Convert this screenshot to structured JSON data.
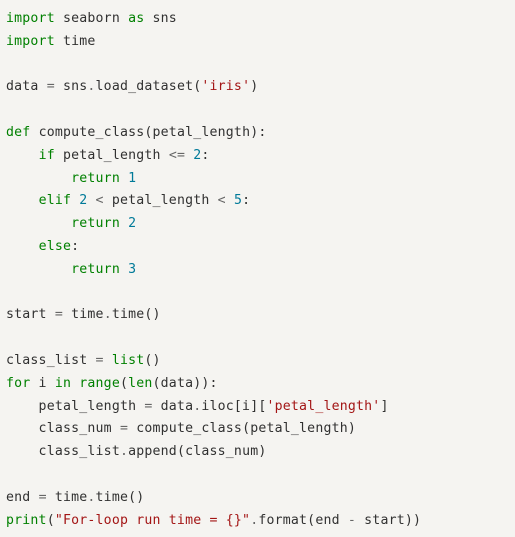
{
  "code": {
    "tokens": [
      [
        [
          "import",
          "kw"
        ],
        [
          " ",
          "nm"
        ],
        [
          "seaborn",
          "nm"
        ],
        [
          " ",
          "nm"
        ],
        [
          "as",
          "kw"
        ],
        [
          " ",
          "nm"
        ],
        [
          "sns",
          "nm"
        ]
      ],
      [
        [
          "import",
          "kw"
        ],
        [
          " ",
          "nm"
        ],
        [
          "time",
          "nm"
        ]
      ],
      [],
      [
        [
          "data ",
          "nm"
        ],
        [
          "=",
          "op"
        ],
        [
          " sns",
          "nm"
        ],
        [
          ".",
          "op"
        ],
        [
          "load_dataset(",
          "nm"
        ],
        [
          "'iris'",
          "str"
        ],
        [
          ")",
          "nm"
        ]
      ],
      [],
      [
        [
          "def",
          "kw"
        ],
        [
          " ",
          "nm"
        ],
        [
          "compute_class",
          "nm"
        ],
        [
          "(petal_length):",
          "nm"
        ]
      ],
      [
        [
          "    ",
          "nm"
        ],
        [
          "if",
          "kw"
        ],
        [
          " petal_length ",
          "nm"
        ],
        [
          "<=",
          "op"
        ],
        [
          " ",
          "nm"
        ],
        [
          "2",
          "num"
        ],
        [
          ":",
          "nm"
        ]
      ],
      [
        [
          "        ",
          "nm"
        ],
        [
          "return",
          "kw"
        ],
        [
          " ",
          "nm"
        ],
        [
          "1",
          "num"
        ]
      ],
      [
        [
          "    ",
          "nm"
        ],
        [
          "elif",
          "kw"
        ],
        [
          " ",
          "nm"
        ],
        [
          "2",
          "num"
        ],
        [
          " ",
          "nm"
        ],
        [
          "<",
          "op"
        ],
        [
          " petal_length ",
          "nm"
        ],
        [
          "<",
          "op"
        ],
        [
          " ",
          "nm"
        ],
        [
          "5",
          "num"
        ],
        [
          ":",
          "nm"
        ]
      ],
      [
        [
          "        ",
          "nm"
        ],
        [
          "return",
          "kw"
        ],
        [
          " ",
          "nm"
        ],
        [
          "2",
          "num"
        ]
      ],
      [
        [
          "    ",
          "nm"
        ],
        [
          "else",
          "kw"
        ],
        [
          ":",
          "nm"
        ]
      ],
      [
        [
          "        ",
          "nm"
        ],
        [
          "return",
          "kw"
        ],
        [
          " ",
          "nm"
        ],
        [
          "3",
          "num"
        ]
      ],
      [],
      [
        [
          "start ",
          "nm"
        ],
        [
          "=",
          "op"
        ],
        [
          " time",
          "nm"
        ],
        [
          ".",
          "op"
        ],
        [
          "time()",
          "nm"
        ]
      ],
      [],
      [
        [
          "class_list ",
          "nm"
        ],
        [
          "=",
          "op"
        ],
        [
          " ",
          "nm"
        ],
        [
          "list",
          "bltn"
        ],
        [
          "()",
          "nm"
        ]
      ],
      [
        [
          "for",
          "kw"
        ],
        [
          " i ",
          "nm"
        ],
        [
          "in",
          "kw"
        ],
        [
          " ",
          "nm"
        ],
        [
          "range",
          "bltn"
        ],
        [
          "(",
          "nm"
        ],
        [
          "len",
          "bltn"
        ],
        [
          "(data)):",
          "nm"
        ]
      ],
      [
        [
          "    petal_length ",
          "nm"
        ],
        [
          "=",
          "op"
        ],
        [
          " data",
          "nm"
        ],
        [
          ".",
          "op"
        ],
        [
          "iloc[i][",
          "nm"
        ],
        [
          "'petal_length'",
          "str"
        ],
        [
          "]",
          "nm"
        ]
      ],
      [
        [
          "    class_num ",
          "nm"
        ],
        [
          "=",
          "op"
        ],
        [
          " compute_class(petal_length)",
          "nm"
        ]
      ],
      [
        [
          "    class_list",
          "nm"
        ],
        [
          ".",
          "op"
        ],
        [
          "append(class_num)",
          "nm"
        ]
      ],
      [],
      [
        [
          "end ",
          "nm"
        ],
        [
          "=",
          "op"
        ],
        [
          " time",
          "nm"
        ],
        [
          ".",
          "op"
        ],
        [
          "time()",
          "nm"
        ]
      ],
      [
        [
          "print",
          "bltn"
        ],
        [
          "(",
          "nm"
        ],
        [
          "\"For-loop run time = {}\"",
          "str"
        ],
        [
          ".",
          "op"
        ],
        [
          "format(end ",
          "nm"
        ],
        [
          "-",
          "op"
        ],
        [
          " start))",
          "nm"
        ]
      ]
    ]
  }
}
